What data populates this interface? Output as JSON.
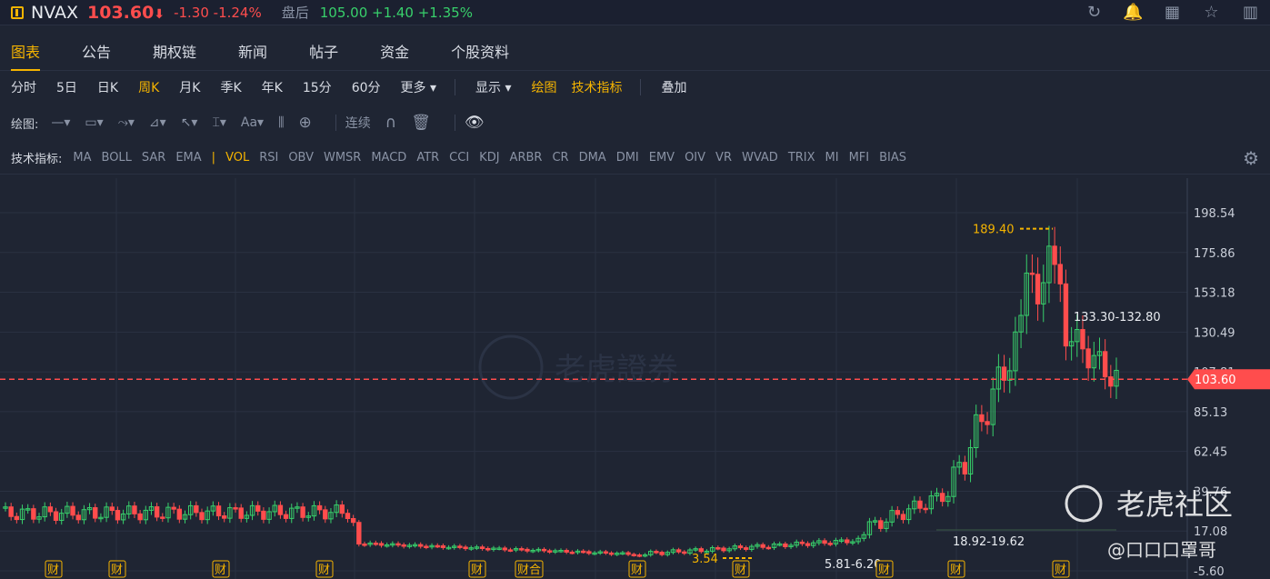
{
  "quote": {
    "symbol": "NVAX",
    "price": "103.60",
    "price_arrow": "⬇",
    "change": "-1.30 -1.24%",
    "after_hours_label": "盘后",
    "after_hours": "105.00 +1.40 +1.35%",
    "icons": [
      "refresh-icon",
      "bell-icon",
      "grid-icon",
      "star-icon",
      "sidebar-toggle-icon"
    ]
  },
  "tabs": [
    "图表",
    "公告",
    "期权链",
    "新闻",
    "帖子",
    "资金",
    "个股资料"
  ],
  "periods": [
    "分时",
    "5日",
    "日K",
    "周K",
    "月K",
    "季K",
    "年K",
    "15分",
    "60分",
    "更多"
  ],
  "period_active": "周K",
  "display_menu": "显示",
  "draw_toggle": "绘图",
  "indicator_toggle": "技术指标",
  "overlay": "叠加",
  "draw_label": "绘图:",
  "continuous": "连续",
  "indicator_label": "技术指标:",
  "indicators": [
    "MA",
    "BOLL",
    "SAR",
    "EMA",
    "|",
    "VOL",
    "RSI",
    "OBV",
    "WMSR",
    "MACD",
    "ATR",
    "CCI",
    "KDJ",
    "ARBR",
    "CR",
    "DMA",
    "DMI",
    "EMV",
    "OIV",
    "VR",
    "WVAD",
    "TRIX",
    "MI",
    "MFI",
    "BIAS"
  ],
  "indicator_active": "VOL",
  "chart_data": {
    "type": "candlestick",
    "y_ticks": [
      "198.54",
      "175.86",
      "153.18",
      "130.49",
      "107.81",
      "85.13",
      "62.45",
      "39.76",
      "17.08",
      "-5.60"
    ],
    "ylim": [
      -5.6,
      198.54
    ],
    "current_price": 103.6,
    "current_price_label": "103.60",
    "annotations": {
      "high": "189.40",
      "recent_range": "133.30-132.80",
      "low_mid": "18.92-19.62",
      "low_bottom": "5.81-6.20",
      "low_left": "3.54"
    },
    "event_markers": [
      "财",
      "财",
      "财",
      "财",
      "财",
      "财合",
      "财",
      "财",
      "财",
      "财",
      "财"
    ],
    "colors": {
      "up": "#38d06b",
      "down": "#ff4d4d",
      "accent": "#f5b400"
    }
  },
  "watermarks": {
    "center": "老虎證券",
    "corner_brand": "老虎社区",
    "corner_user": "@口口口罩哥"
  }
}
